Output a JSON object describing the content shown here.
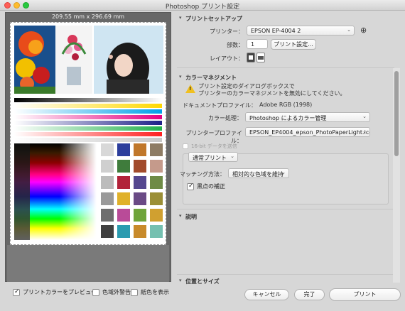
{
  "window": {
    "title": "Photoshop プリント設定"
  },
  "preview": {
    "paper_size": "209.55 mm x 296.69 mm",
    "color_bars": [
      "#222222",
      "#ffffff",
      "#ffd800",
      "#00a0e9",
      "#e4007f",
      "#00a0e9",
      "#ff66cc",
      "#1d2088",
      "#22b14c",
      "#6ac46a",
      "#ffffff",
      "#d0d0d0"
    ],
    "swatches": [
      "#d8d8d8",
      "#2c3e9c",
      "#c0772a",
      "#8e7c64",
      "#cfcfcf",
      "#3f7c3c",
      "#a24b2c",
      "#c59a8b",
      "#bcbcbc",
      "#b2233a",
      "#55478f",
      "#6f8b46",
      "#9a9a9a",
      "#e0b12a",
      "#6a4a85",
      "#9b8f36",
      "#6e6e6e",
      "#b94b98",
      "#6fa43a",
      "#d0a030",
      "#404040",
      "#2b9bb0",
      "#c88a2a",
      "#75c0b0"
    ]
  },
  "preview_options": {
    "preview_label": "プリントカラーをプレビュー",
    "gamut_label": "色域外警告",
    "paper_color_label": "紙色を表示"
  },
  "print_setup": {
    "title": "プリントセットアップ",
    "printer_label": "プリンター：",
    "printer_value": "EPSON EP-4004 2",
    "copies_label": "部数：",
    "copies_value": "1",
    "print_settings_button": "プリント設定...",
    "layout_label": "レイアウト："
  },
  "color_management": {
    "title": "カラーマネジメント",
    "warning_text_1": "プリント設定のダイアログボックスで",
    "warning_text_2": "プリンターのカラーマネジメントを無効にしてください。",
    "doc_profile_label": "ドキュメントプロファイル：",
    "doc_profile_value": "Adobe RGB (1998)",
    "color_handling_label": "カラー処理：",
    "color_handling_value": "Photoshop によるカラー管理",
    "printer_profile_label": "プリンタープロファイル：",
    "printer_profile_value": "EPSON_EP4004_epson_PhotoPaperLight.icc",
    "bit_label": "16-bit データを送信",
    "print_mode_value": "通常プリント",
    "matching_label": "マッチング方法：",
    "matching_value": "相対的な色域を維持",
    "black_point_label": "黒点の補正"
  },
  "description": {
    "title": "説明"
  },
  "position_size": {
    "title": "位置とサイズ"
  },
  "footer": {
    "cancel": "キャンセル",
    "done": "完了",
    "print": "プリント"
  }
}
